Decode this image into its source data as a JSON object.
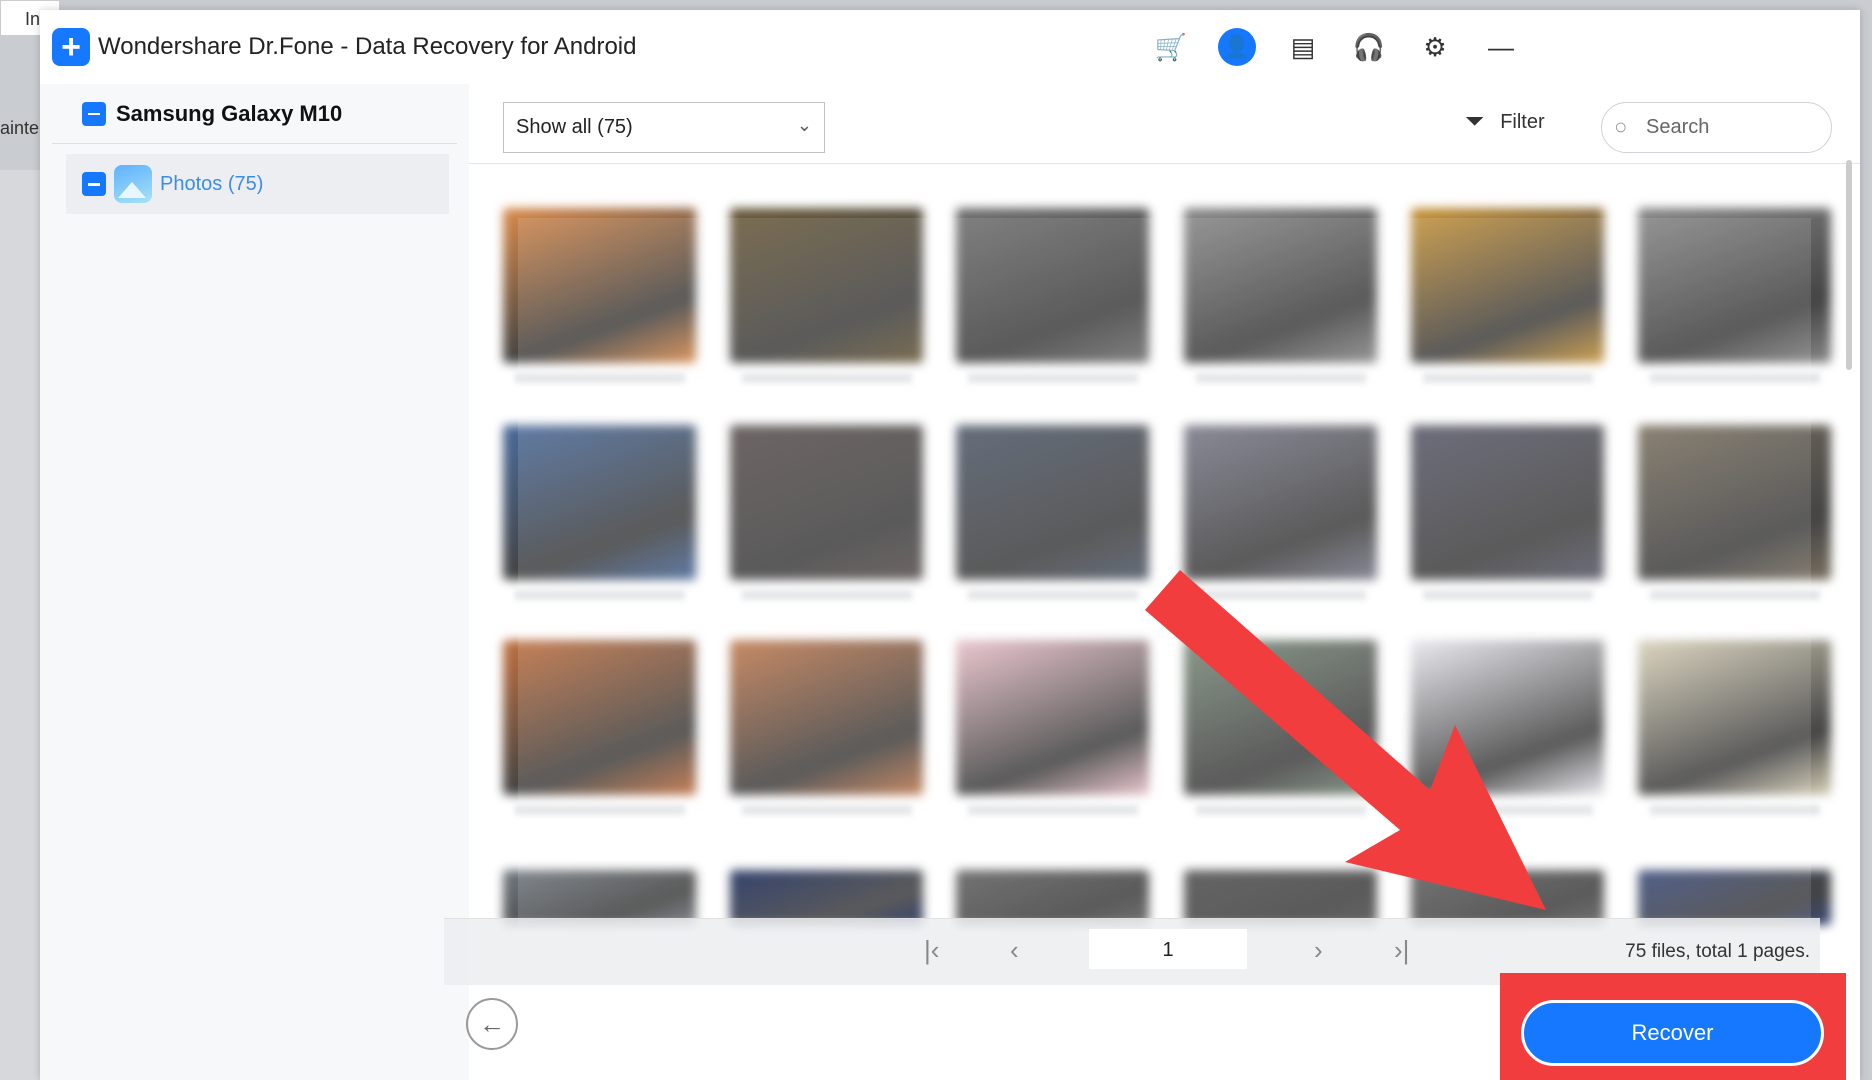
{
  "background": {
    "tab_text": "In",
    "side_text": "ainte"
  },
  "window": {
    "title": "Wondershare Dr.Fone - Data Recovery for Android"
  },
  "header_icons": [
    "cart-icon",
    "user-icon",
    "feedback-icon",
    "support-icon",
    "settings-icon",
    "minimize-icon"
  ],
  "sidebar": {
    "device": "Samsung Galaxy M10",
    "items": [
      {
        "label": "Photos (75)"
      }
    ]
  },
  "toolbar": {
    "select_value": "Show all (75)",
    "filter_label": "Filter",
    "search_placeholder": "Search"
  },
  "thumbnails": [
    [
      "#d98a4a",
      "#6a5a3a",
      "#707070",
      "#8a8a8a",
      "#c9953a",
      "#888"
    ],
    [
      "#4a6a9a",
      "#5a5050",
      "#505a6a",
      "#7a7a8a",
      "#5a5a6a",
      "#7a7060"
    ],
    [
      "#c07040",
      "#c07a50",
      "#e8c0c8",
      "#7a8a7a",
      "#e8e8ee",
      "#d8d0b8"
    ],
    [
      "#707880",
      "#1a2a5a",
      "#606060",
      "#505050",
      "#606060",
      "#3a4a7a"
    ]
  ],
  "pager": {
    "page": "1",
    "status": "75 files, total 1 pages."
  },
  "footer": {
    "recover_label": "Recover"
  },
  "colors": {
    "accent": "#1677ff",
    "annotation": "#f13d3d"
  }
}
